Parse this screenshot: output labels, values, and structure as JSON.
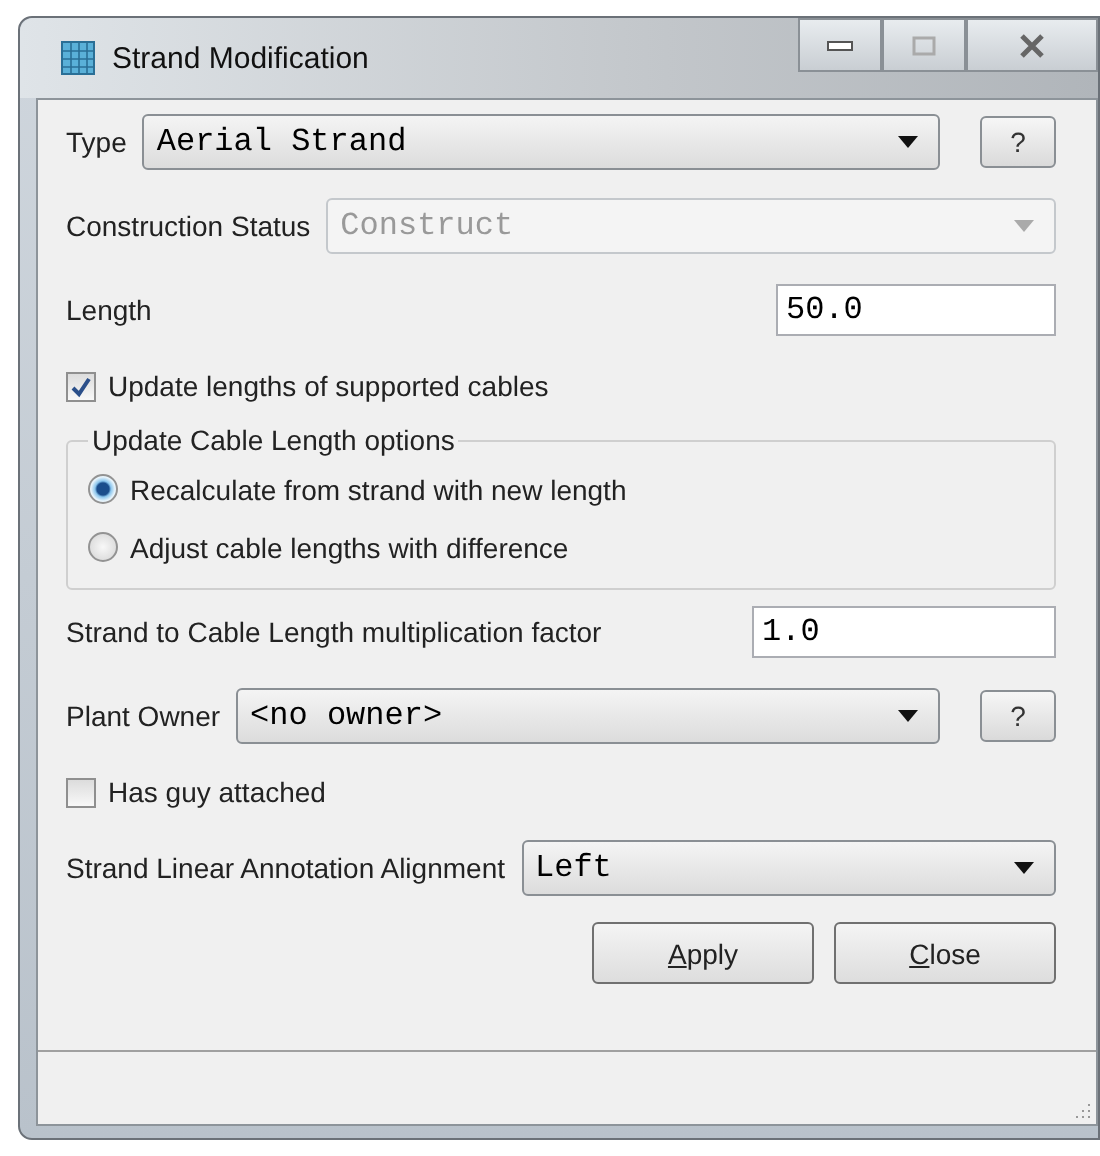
{
  "window": {
    "title": "Strand Modification"
  },
  "type": {
    "label": "Type",
    "value": "Aerial Strand",
    "help": "?"
  },
  "construction_status": {
    "label": "Construction Status",
    "value": "Construct",
    "disabled": true
  },
  "length": {
    "label": "Length",
    "value": "50.0"
  },
  "update_lengths": {
    "label": "Update lengths of supported cables",
    "checked": true
  },
  "cable_length_options": {
    "title": "Update Cable Length options",
    "options": [
      {
        "label": "Recalculate from strand with new length",
        "selected": true
      },
      {
        "label": "Adjust cable lengths with difference",
        "selected": false
      }
    ]
  },
  "multiplication_factor": {
    "label": "Strand to Cable Length multiplication factor",
    "value": "1.0"
  },
  "plant_owner": {
    "label": "Plant Owner",
    "value": "<no owner>",
    "help": "?"
  },
  "has_guy": {
    "label": "Has guy attached",
    "checked": false
  },
  "annotation_alignment": {
    "label": "Strand Linear Annotation Alignment",
    "value": "Left"
  },
  "buttons": [
    {
      "mnemonic": "A",
      "rest": "pply"
    },
    {
      "mnemonic": "C",
      "rest": "lose"
    }
  ]
}
